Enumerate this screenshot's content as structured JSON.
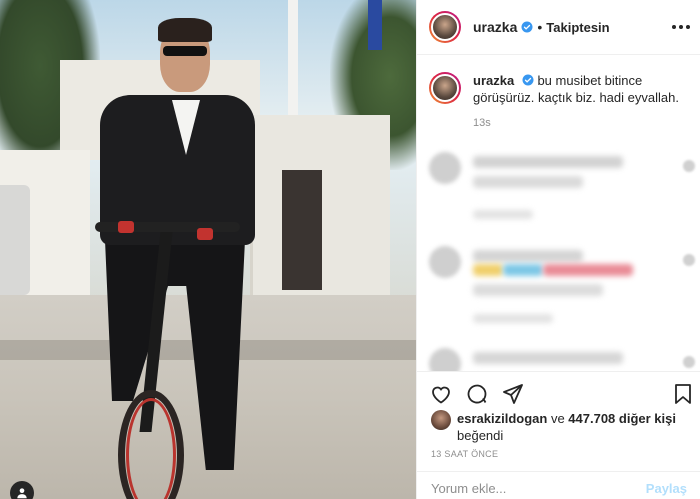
{
  "post": {
    "username": "urazka",
    "verified": true,
    "follow_state": "Takiptesin",
    "caption_user": "urazka",
    "caption_text": "bu musibet bitince görüşürüz. kaçtık biz. hadi eyvallah.",
    "caption_time": "13s",
    "liked_by_user": "esrakizildogan",
    "likes_joiner": "ve",
    "likes_count": "447.708 diğer kişi",
    "likes_suffix": "beğendi",
    "posted_ago": "13 SAAT ÖNCE"
  },
  "comment_box": {
    "placeholder": "Yorum ekle...",
    "post_label": "Paylaş"
  },
  "icons": {
    "like": "heart-icon",
    "comment": "comment-icon",
    "share": "share-icon",
    "save": "bookmark-icon",
    "more": "more-icon",
    "verified": "verified-badge-icon",
    "user_tag": "user-tag-icon"
  },
  "colors": {
    "text": "#262626",
    "muted": "#8e8e8e",
    "verified": "#3897f0",
    "post_disabled": "#b2dffc",
    "border": "#efefef"
  }
}
